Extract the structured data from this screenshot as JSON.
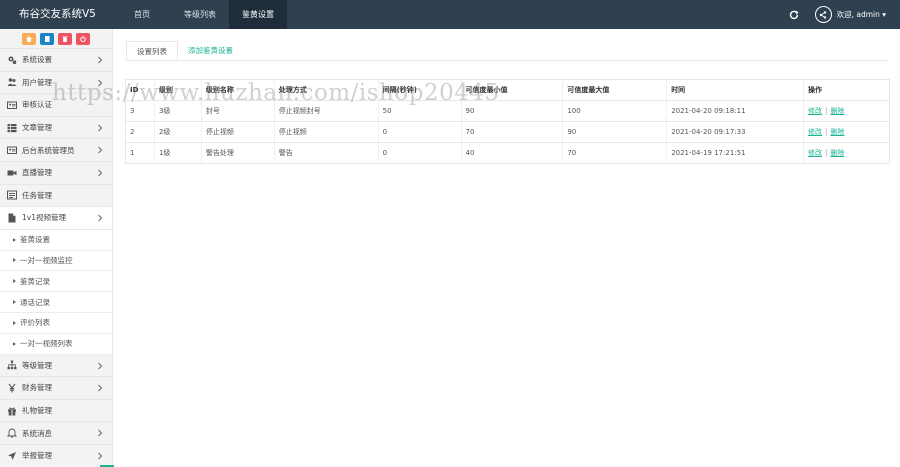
{
  "app": {
    "title": "布谷交友系统V5"
  },
  "topnav": [
    {
      "label": "首页"
    },
    {
      "label": "等级列表"
    },
    {
      "label": "鉴黄设置"
    }
  ],
  "user": {
    "welcome": "欢迎, admin ▾"
  },
  "colors": {
    "topbar": "#2f4050",
    "accent": "#1ab394",
    "qb1": "#f8ac59",
    "qb2": "#1c84c6",
    "qb3": "#ed5565",
    "qb4": "#ed5565"
  },
  "sidebar": {
    "items": [
      {
        "label": "系统设置"
      },
      {
        "label": "用户管理"
      },
      {
        "label": "审核认证"
      },
      {
        "label": "文章管理"
      },
      {
        "label": "后台系统管理员"
      },
      {
        "label": "直播管理"
      },
      {
        "label": "任务管理"
      },
      {
        "label": "1v1视频管理"
      }
    ],
    "subitems": [
      {
        "label": "鉴黄设置"
      },
      {
        "label": "一对一视频监控"
      },
      {
        "label": "鉴黄记录"
      },
      {
        "label": "通话记录"
      },
      {
        "label": "评价列表"
      },
      {
        "label": "一对一视频列表"
      }
    ],
    "items_after": [
      {
        "label": "等级管理"
      },
      {
        "label": "财务管理"
      },
      {
        "label": "礼物管理"
      },
      {
        "label": "系统消息"
      },
      {
        "label": "举报管理"
      }
    ]
  },
  "tabs": [
    {
      "label": "设置列表"
    },
    {
      "label": "添加鉴黄设置"
    }
  ],
  "table": {
    "headers": [
      "ID",
      "级别",
      "级别名称",
      "处理方式",
      "间隔(秒钟)",
      "可信度最小值",
      "可信度最大值",
      "时间",
      "操作"
    ],
    "rows": [
      [
        "3",
        "3级",
        "封号",
        "停止视频封号",
        "50",
        "90",
        "100",
        "2021-04-20 09:18:11"
      ],
      [
        "2",
        "2级",
        "停止视频",
        "停止视频",
        "0",
        "70",
        "90",
        "2021-04-20 09:17:33"
      ],
      [
        "1",
        "1级",
        "警告处理",
        "警告",
        "0",
        "40",
        "70",
        "2021-04-19 17:21:51"
      ]
    ],
    "edit_label": "修改",
    "separator": "|",
    "delete_label": "删除"
  },
  "watermark": "https://www.huzhan.com/ishop20445"
}
